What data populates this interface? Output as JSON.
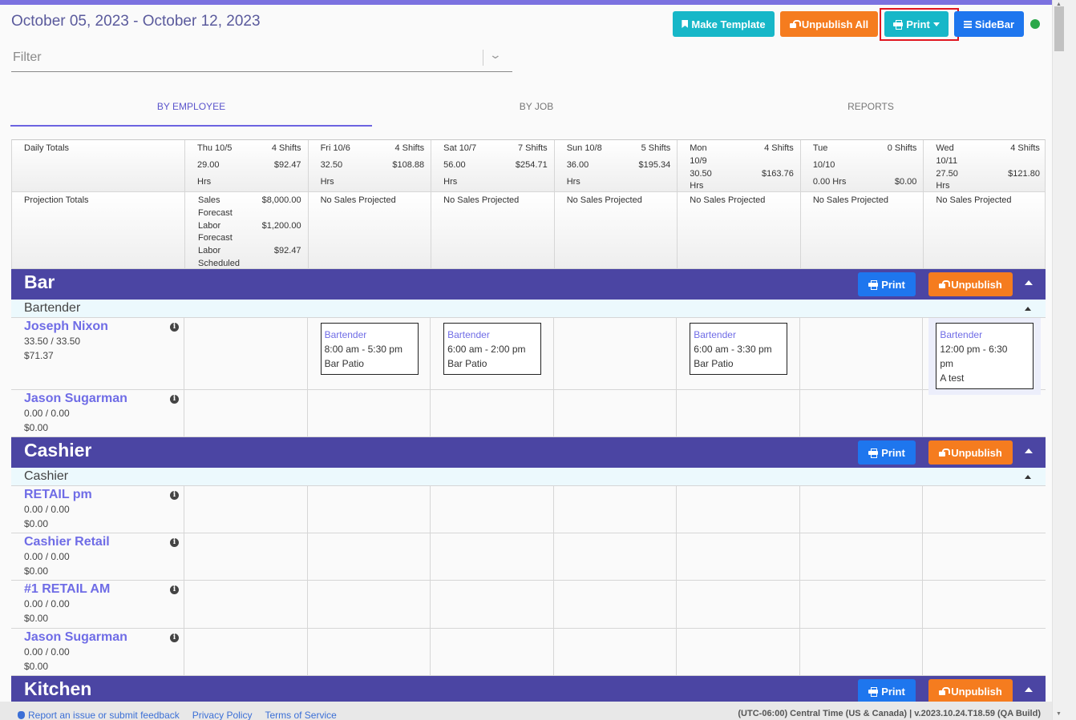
{
  "header": {
    "date_range": "October 05, 2023 - October 12, 2023",
    "filter_placeholder": "Filter",
    "buttons": {
      "make_template": "Make Template",
      "unpublish_all": "Unpublish All",
      "print": "Print",
      "sidebar": "SideBar"
    }
  },
  "tabs": [
    "BY EMPLOYEE",
    "BY JOB",
    "REPORTS"
  ],
  "daily_totals": {
    "label": "Daily Totals",
    "days": [
      {
        "day": "Thu 10/5",
        "shifts": "4 Shifts",
        "hours": "29.00",
        "hrs_unit": "Hrs",
        "cost": "$92.47"
      },
      {
        "day": "Fri 10/6",
        "shifts": "4 Shifts",
        "hours": "32.50",
        "hrs_unit": "Hrs",
        "cost": "$108.88"
      },
      {
        "day": "Sat 10/7",
        "shifts": "7 Shifts",
        "hours": "56.00",
        "hrs_unit": "Hrs",
        "cost": "$254.71"
      },
      {
        "day": "Sun 10/8",
        "shifts": "5 Shifts",
        "hours": "36.00",
        "hrs_unit": "Hrs",
        "cost": "$195.34"
      },
      {
        "day": "Mon",
        "day2": "10/9",
        "shifts": "4 Shifts",
        "hours": "30.50",
        "hrs_unit": "Hrs",
        "cost": "$163.76"
      },
      {
        "day": "Tue",
        "day2": "10/10",
        "shifts": "0 Shifts",
        "hours": "0.00 Hrs",
        "cost": "$0.00"
      },
      {
        "day": "Wed",
        "day2": "10/11",
        "shifts": "4 Shifts",
        "hours": "27.50",
        "hrs_unit": "Hrs",
        "cost": "$121.80"
      }
    ]
  },
  "projection_totals": {
    "label": "Projection Totals",
    "first_day": {
      "sales_label": "Sales",
      "sales_value": "$8,000.00",
      "forecast_labor_label_1": "Forecast",
      "forecast_labor_label_2": "Labor",
      "forecast_labor_value": "$1,200.00",
      "forecast_labor2_label_1": "Forecast",
      "forecast_labor2_label_2": "Labor",
      "forecast_labor2_value": "$92.47",
      "scheduled_label": "Scheduled"
    },
    "no_sales": "No Sales Projected"
  },
  "sections": [
    {
      "title": "Bar",
      "print": "Print",
      "unpublish": "Unpublish",
      "subsection": "Bartender",
      "employees": [
        {
          "name": "Joseph Nixon",
          "hours": "33.50 / 33.50",
          "cost": "$71.37"
        },
        {
          "name": "Jason Sugarman",
          "hours": "0.00 / 0.00",
          "cost": "$0.00"
        }
      ],
      "shifts": [
        {
          "job": "Bartender",
          "time": "8:00 am - 5:30 pm",
          "location": "Bar Patio"
        },
        {
          "job": "Bartender",
          "time": "6:00 am - 2:00 pm",
          "location": "Bar Patio"
        },
        {
          "job": "Bartender",
          "time": "6:00 am - 3:30 pm",
          "location": "Bar Patio"
        },
        {
          "job": "Bartender",
          "time_1": "12:00 pm - 6:30",
          "time_2": "pm",
          "location": "A test"
        }
      ]
    },
    {
      "title": "Cashier",
      "print": "Print",
      "unpublish": "Unpublish",
      "subsection": "Cashier",
      "employees": [
        {
          "name": "RETAIL pm",
          "hours": "0.00 / 0.00",
          "cost": "$0.00"
        },
        {
          "name": "Cashier Retail",
          "hours": "0.00 / 0.00",
          "cost": "$0.00"
        },
        {
          "name": "#1 RETAIL AM",
          "hours": "0.00 / 0.00",
          "cost": "$0.00"
        },
        {
          "name": "Jason Sugarman",
          "hours": "0.00 / 0.00",
          "cost": "$0.00"
        }
      ]
    },
    {
      "title": "Kitchen",
      "print": "Print",
      "unpublish": "Unpublish"
    }
  ],
  "footer": {
    "report": "Report an issue or submit feedback",
    "privacy": "Privacy Policy",
    "terms": "Terms of Service",
    "version": "(UTC-06:00) Central Time (US & Canada) | v.2023.10.24.T18.59 (QA Build)"
  },
  "colors": {
    "accent": "#4b45a3",
    "teal": "#17b7c8",
    "orange": "#f57c1f",
    "blue": "#1e76ee",
    "status_online": "#2ba84a"
  }
}
